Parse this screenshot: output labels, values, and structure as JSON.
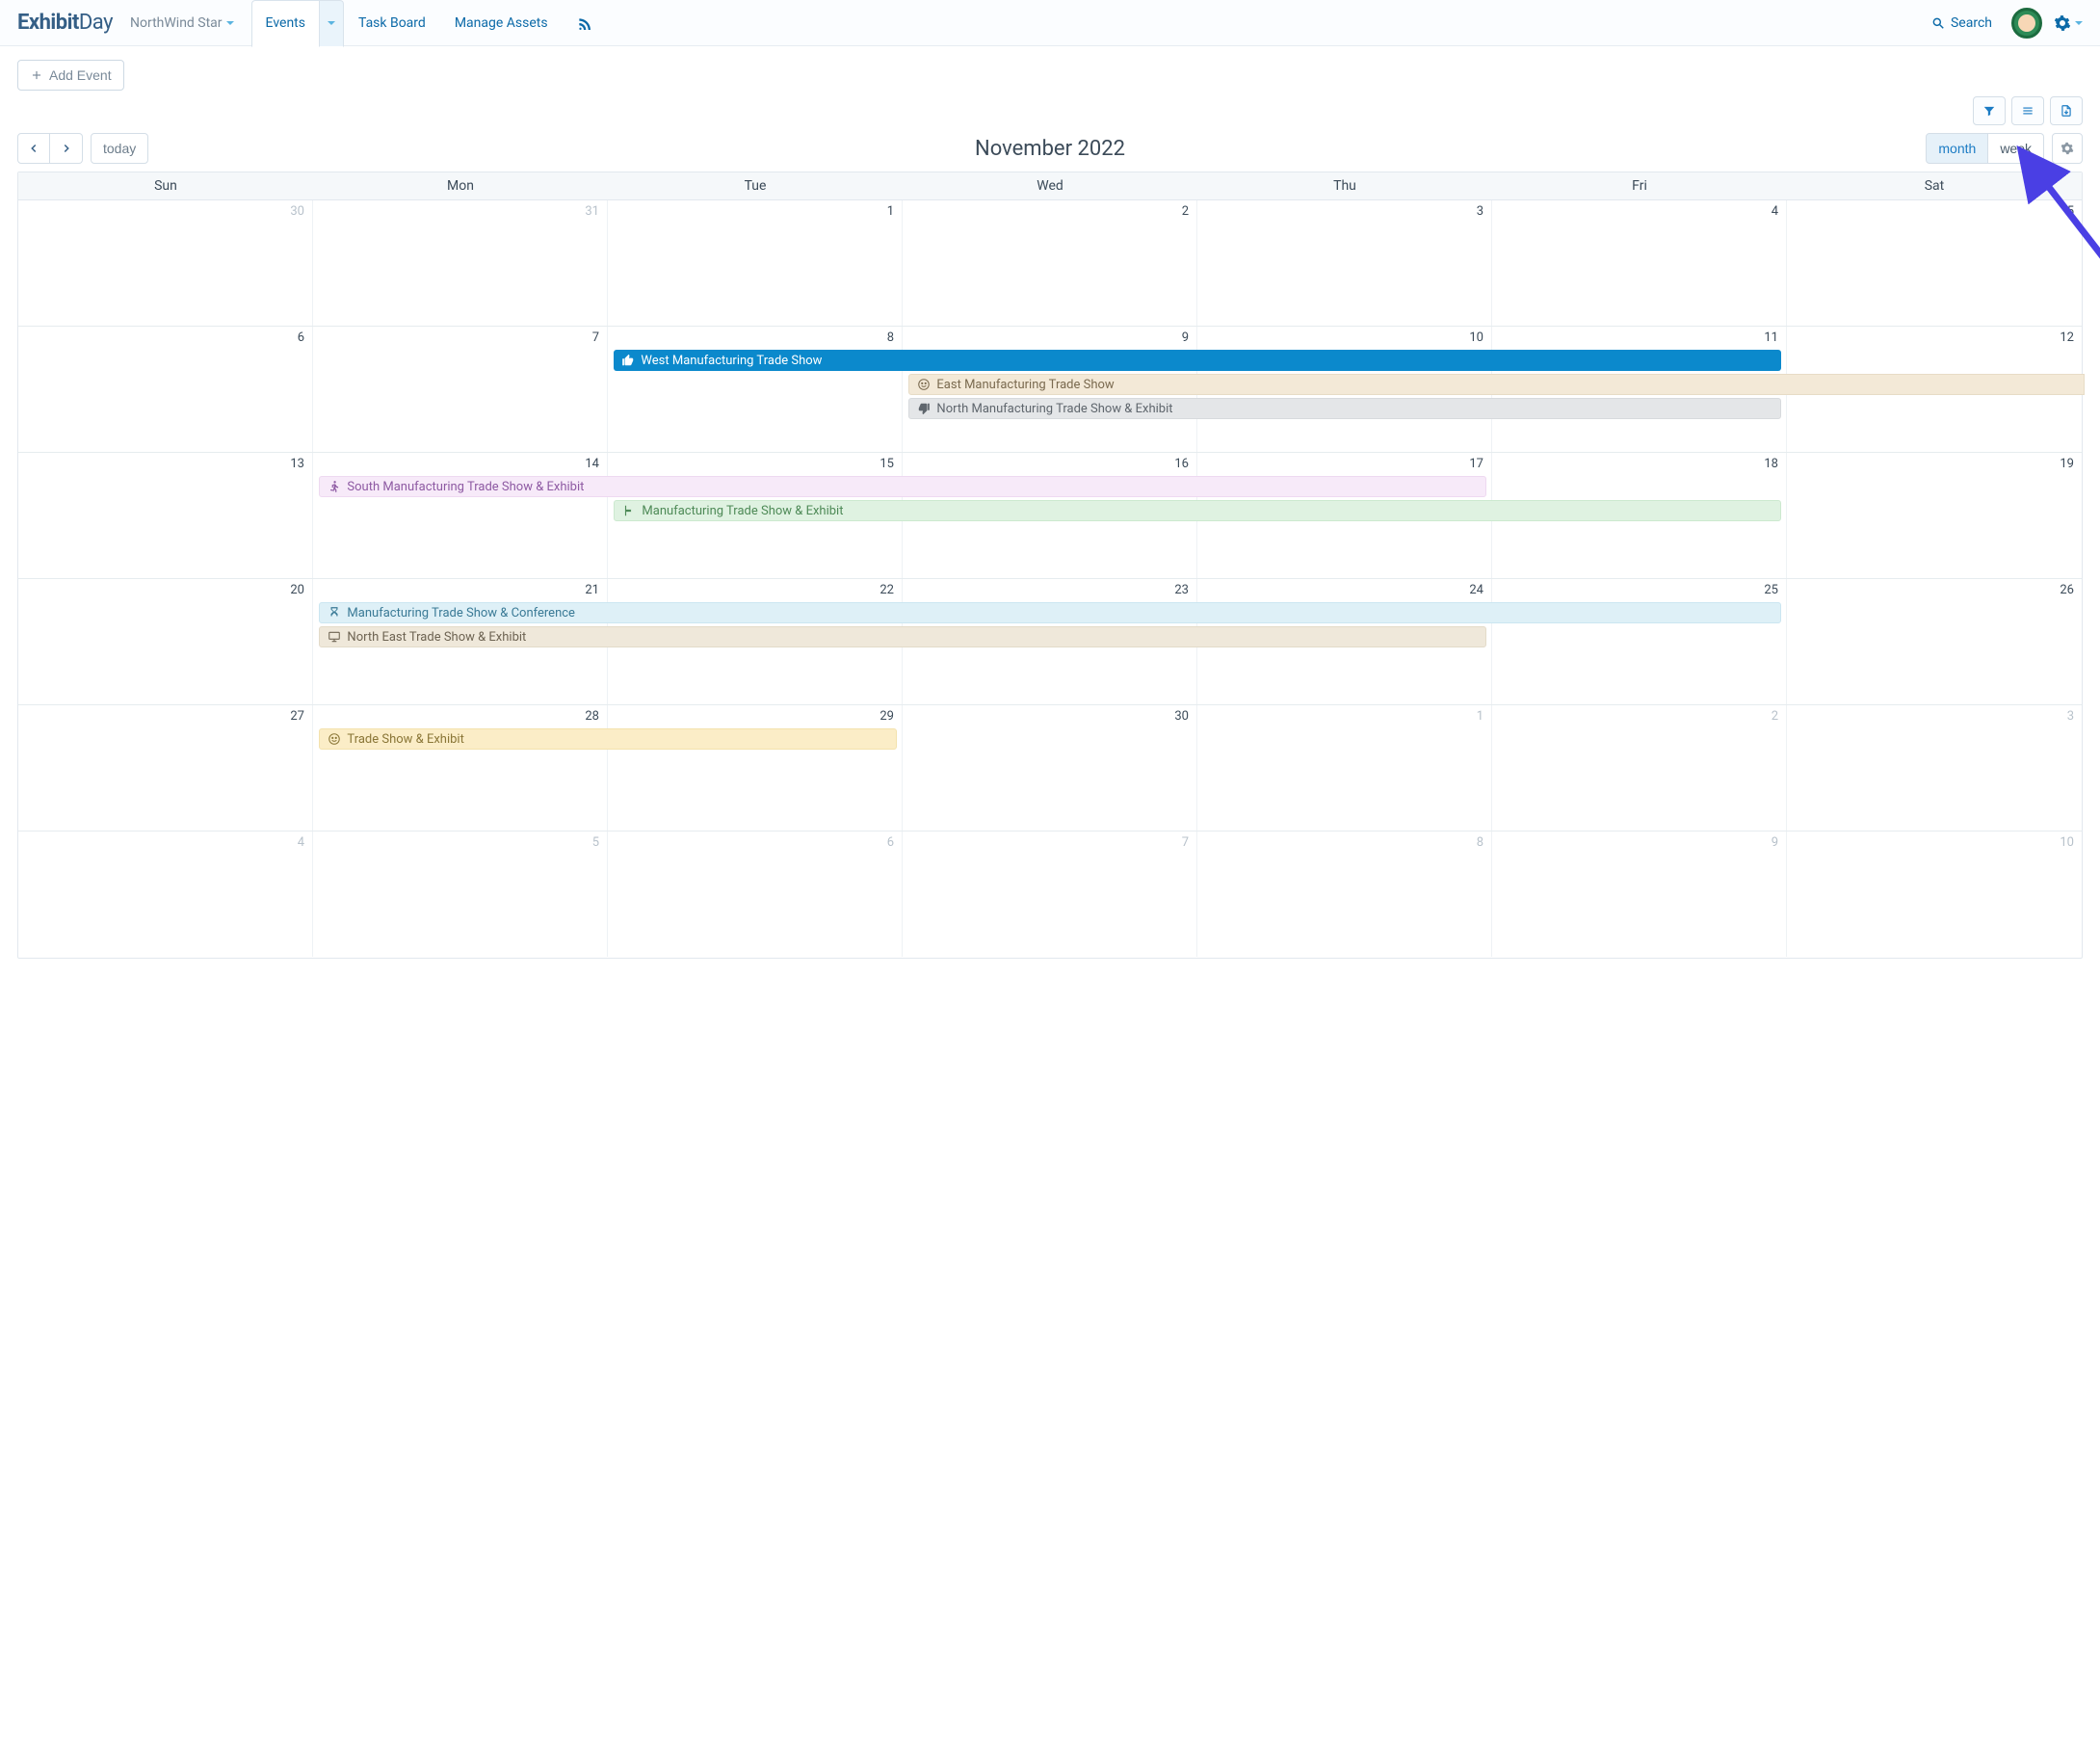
{
  "brand": {
    "part1": "Exhibit",
    "part2": "Day"
  },
  "workspace": "NorthWind Star",
  "nav": {
    "events": "Events",
    "task_board": "Task Board",
    "manage_assets": "Manage Assets"
  },
  "search_label": "Search",
  "add_event_label": "Add Event",
  "today_label": "today",
  "title": "November 2022",
  "view": {
    "month": "month",
    "week": "week",
    "active": "month"
  },
  "dow": [
    "Sun",
    "Mon",
    "Tue",
    "Wed",
    "Thu",
    "Fri",
    "Sat"
  ],
  "weeks": [
    {
      "days": [
        {
          "n": "30",
          "o": true
        },
        {
          "n": "31",
          "o": true
        },
        {
          "n": "1"
        },
        {
          "n": "2"
        },
        {
          "n": "3"
        },
        {
          "n": "4"
        },
        {
          "n": "5"
        }
      ],
      "events": []
    },
    {
      "days": [
        {
          "n": "6"
        },
        {
          "n": "7"
        },
        {
          "n": "8"
        },
        {
          "n": "9"
        },
        {
          "n": "10"
        },
        {
          "n": "11"
        },
        {
          "n": "12"
        }
      ],
      "events": [
        {
          "label": "West Manufacturing Trade Show",
          "start": 2,
          "span": 4,
          "row": 0,
          "cls": "c-blue",
          "icon": "thumbs-up"
        },
        {
          "label": "East Manufacturing Trade Show",
          "start": 3,
          "span": 4,
          "row": 1,
          "cls": "c-tan",
          "icon": "smile",
          "bleed_right": true
        },
        {
          "label": "North Manufacturing Trade Show & Exhibit",
          "start": 3,
          "span": 3,
          "row": 2,
          "cls": "c-grey",
          "icon": "thumbs-down"
        }
      ]
    },
    {
      "days": [
        {
          "n": "13"
        },
        {
          "n": "14"
        },
        {
          "n": "15"
        },
        {
          "n": "16"
        },
        {
          "n": "17"
        },
        {
          "n": "18"
        },
        {
          "n": "19"
        }
      ],
      "events": [
        {
          "label": "South Manufacturing Trade Show & Exhibit",
          "start": 1,
          "span": 4,
          "row": 0,
          "cls": "c-pink",
          "icon": "walk"
        },
        {
          "label": "Manufacturing Trade Show & Exhibit",
          "start": 2,
          "span": 4,
          "row": 1,
          "cls": "c-green",
          "icon": "flag"
        }
      ]
    },
    {
      "days": [
        {
          "n": "20"
        },
        {
          "n": "21"
        },
        {
          "n": "22"
        },
        {
          "n": "23"
        },
        {
          "n": "24"
        },
        {
          "n": "25"
        },
        {
          "n": "26"
        }
      ],
      "events": [
        {
          "label": "Manufacturing Trade Show & Conference",
          "start": 1,
          "span": 5,
          "row": 0,
          "cls": "c-ltblue",
          "icon": "hourglass"
        },
        {
          "label": "North East Trade Show & Exhibit",
          "start": 1,
          "span": 4,
          "row": 1,
          "cls": "c-sand",
          "icon": "monitor"
        }
      ]
    },
    {
      "days": [
        {
          "n": "27"
        },
        {
          "n": "28"
        },
        {
          "n": "29"
        },
        {
          "n": "30"
        },
        {
          "n": "1",
          "o": true
        },
        {
          "n": "2",
          "o": true
        },
        {
          "n": "3",
          "o": true
        }
      ],
      "events": [
        {
          "label": "Trade Show & Exhibit",
          "start": 1,
          "span": 2,
          "row": 0,
          "cls": "c-yellow",
          "icon": "smile"
        }
      ]
    },
    {
      "days": [
        {
          "n": "4",
          "o": true
        },
        {
          "n": "5",
          "o": true
        },
        {
          "n": "6",
          "o": true
        },
        {
          "n": "7",
          "o": true
        },
        {
          "n": "8",
          "o": true
        },
        {
          "n": "9",
          "o": true
        },
        {
          "n": "10",
          "o": true
        }
      ],
      "events": []
    }
  ]
}
